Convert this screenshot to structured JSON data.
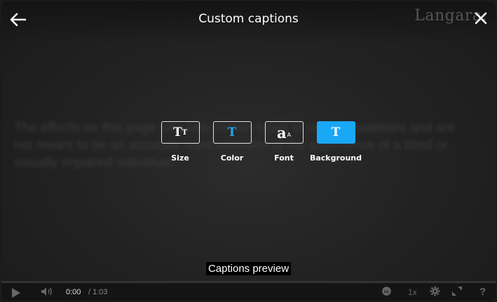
{
  "header": {
    "title": "Custom captions",
    "brand": "Langara."
  },
  "background_text": "The effects on this page simulate certain types of visual disabilities and are not meant to be an accurate representation of the experience of a blind or visually impaired individual.",
  "options": [
    {
      "label": "Size",
      "icon": "text-size-icon",
      "glyph": "T",
      "glyph_small": "T"
    },
    {
      "label": "Color",
      "icon": "text-color-icon",
      "glyph": "T"
    },
    {
      "label": "Font",
      "icon": "font-icon",
      "glyph": "a",
      "glyph_small": "A"
    },
    {
      "label": "Background",
      "icon": "background-icon",
      "glyph": "T",
      "active": true
    }
  ],
  "preview": "Captions preview",
  "player": {
    "current_time": "0:00",
    "duration": "/ 1:03",
    "speed": "1x",
    "help": "?"
  },
  "colors": {
    "accent": "#19a8f5"
  }
}
